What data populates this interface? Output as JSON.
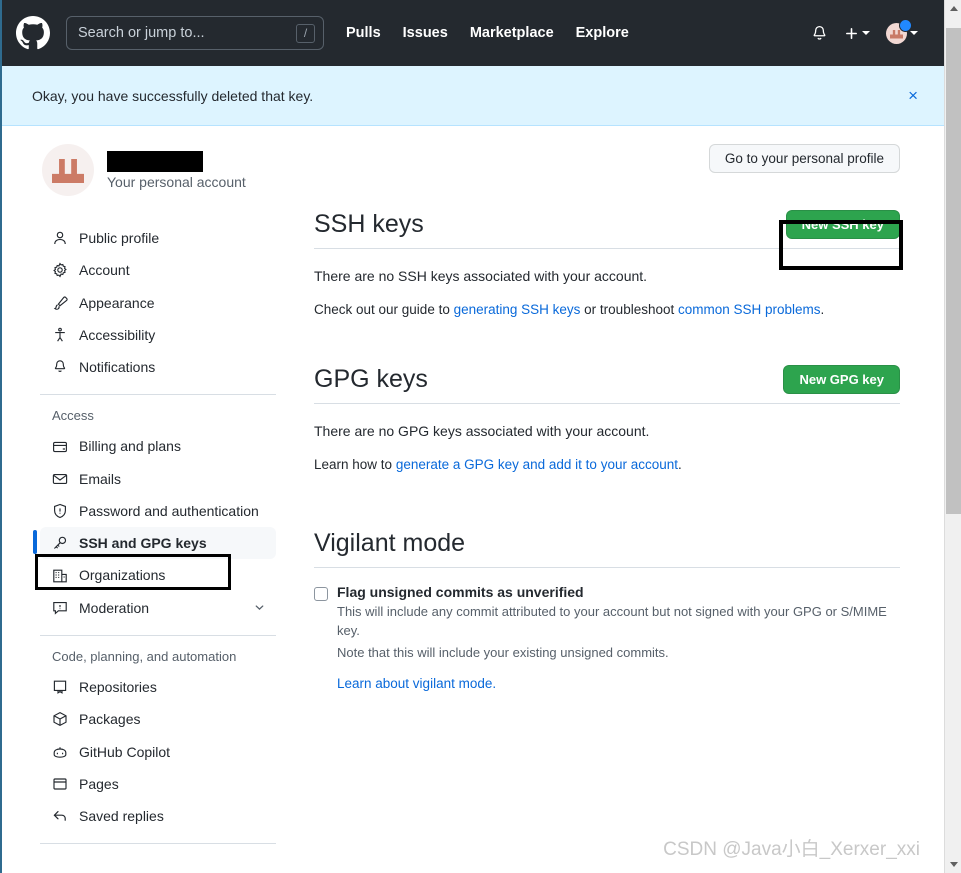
{
  "header": {
    "logo_icon": "github-mark-icon",
    "search": {
      "placeholder": "Search or jump to...",
      "shortcut_key": "/"
    },
    "nav": [
      {
        "label": "Pulls"
      },
      {
        "label": "Issues"
      },
      {
        "label": "Marketplace"
      },
      {
        "label": "Explore"
      }
    ],
    "notifications_icon": "bell-icon",
    "create_new_icon": "plus-icon",
    "avatar_icon": "user-avatar-icon"
  },
  "flash": {
    "message": "Okay, you have successfully deleted that key.",
    "close_label": "×",
    "background_color": "#ddf4ff"
  },
  "account": {
    "name_redacted": "",
    "subtitle": "Your personal account"
  },
  "sidebar": {
    "items": [
      {
        "label": "Public profile",
        "icon": "person-icon",
        "active": false
      },
      {
        "label": "Account",
        "icon": "gear-icon",
        "active": false
      },
      {
        "label": "Appearance",
        "icon": "paintbrush-icon",
        "active": false
      },
      {
        "label": "Accessibility",
        "icon": "accessibility-icon",
        "active": false
      },
      {
        "label": "Notifications",
        "icon": "bell-icon",
        "active": false
      }
    ],
    "access_group": {
      "title": "Access",
      "items": [
        {
          "label": "Billing and plans",
          "icon": "credit-card-icon",
          "active": false
        },
        {
          "label": "Emails",
          "icon": "mail-icon",
          "active": false
        },
        {
          "label": "Password and authentication",
          "icon": "shield-lock-icon",
          "active": false
        },
        {
          "label": "SSH and GPG keys",
          "icon": "key-icon",
          "active": true
        },
        {
          "label": "Organizations",
          "icon": "organization-icon",
          "active": false
        },
        {
          "label": "Moderation",
          "icon": "report-icon",
          "active": false,
          "chevron": "chevron-down-icon"
        }
      ]
    },
    "code_group": {
      "title": "Code, planning, and automation",
      "items": [
        {
          "label": "Repositories",
          "icon": "repo-icon",
          "active": false
        },
        {
          "label": "Packages",
          "icon": "package-icon",
          "active": false
        },
        {
          "label": "GitHub Copilot",
          "icon": "copilot-icon",
          "active": false
        },
        {
          "label": "Pages",
          "icon": "browser-icon",
          "active": false
        },
        {
          "label": "Saved replies",
          "icon": "reply-icon",
          "active": false
        }
      ]
    }
  },
  "main": {
    "personal_profile_button": "Go to your personal profile",
    "ssh": {
      "title": "SSH keys",
      "new_button": "New SSH key",
      "empty_text": "There are no SSH keys associated with your account.",
      "help_prefix": "Check out our guide to ",
      "help_link1": "generating SSH keys",
      "help_middle": " or troubleshoot ",
      "help_link2": "common SSH problems",
      "help_suffix": "."
    },
    "gpg": {
      "title": "GPG keys",
      "new_button": "New GPG key",
      "empty_text": "There are no GPG keys associated with your account.",
      "help_prefix": "Learn how to ",
      "help_link1": "generate a GPG key and add it to your account",
      "help_suffix": "."
    },
    "vigilant": {
      "title": "Vigilant mode",
      "checkbox_label": "Flag unsigned commits as unverified",
      "checkbox_checked": false,
      "description_line1": "This will include any commit attributed to your account but not signed with your GPG or S/MIME key.",
      "description_line2": "Note that this will include your existing unsigned commits.",
      "learn_link": "Learn about vigilant mode."
    }
  },
  "watermark": "CSDN @Java小白_Xerxer_xxi",
  "colors": {
    "header_bg": "#24292f",
    "accent_green": "#2da44e",
    "link_blue": "#0969da",
    "flash_blue": "#ddf4ff",
    "highlight_box": "#000000"
  }
}
